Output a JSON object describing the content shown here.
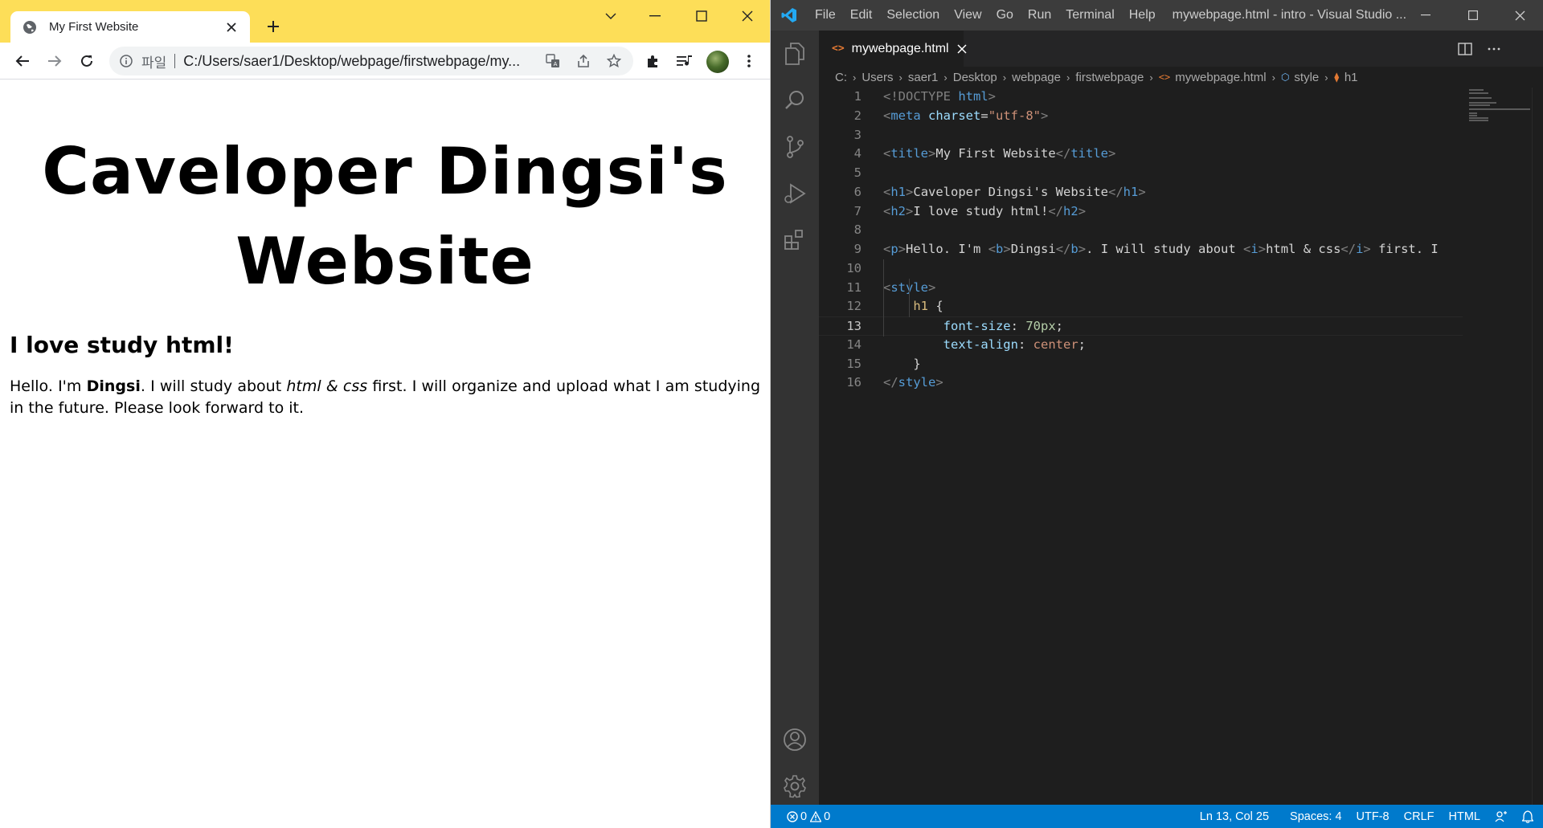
{
  "browser": {
    "tab": {
      "title": "My First Website"
    },
    "omnibox": {
      "security_label": "파일",
      "url": "C:/Users/saer1/Desktop/webpage/firstwebpage/my..."
    },
    "page": {
      "h1": "Caveloper Dingsi's Website",
      "h2": "I love study html!",
      "paragraph": {
        "part1": "Hello. I'm ",
        "bold": "Dingsi",
        "part2": ". I will study about ",
        "italic": "html & css",
        "part3": " first. I will organize and upload what I am studying in the future. Please look forward to it."
      }
    },
    "colors": {
      "titlebar": "#fdde58"
    }
  },
  "vscode": {
    "menu": [
      "File",
      "Edit",
      "Selection",
      "View",
      "Go",
      "Run",
      "Terminal",
      "Help"
    ],
    "window_title": "mywebpage.html - intro - Visual Studio ...",
    "tab": {
      "label": "mywebpage.html"
    },
    "breadcrumb": [
      "C:",
      "Users",
      "saer1",
      "Desktop",
      "webpage",
      "firstwebpage",
      "mywebpage.html",
      "style",
      "h1"
    ],
    "line_numbers": [
      "1",
      "2",
      "3",
      "4",
      "5",
      "6",
      "7",
      "8",
      "9",
      "10",
      "11",
      "12",
      "13",
      "14",
      "15",
      "16"
    ],
    "code": {
      "l1_doctype": "<!DOCTYPE",
      "l1_html": "html",
      "l2_meta": "meta",
      "l2_attr": "charset",
      "l2_val": "\"utf-8\"",
      "l4_title_tag": "title",
      "l4_title_text": "My First Website",
      "l6_tag": "h1",
      "l6_text": "Caveloper Dingsi's Website",
      "l7_tag": "h2",
      "l7_text": "I love study html!",
      "l9_p": "p",
      "l9_t1": "Hello. I'm ",
      "l9_b": "b",
      "l9_t2": "Dingsi",
      "l9_t3": ". I will study about ",
      "l9_i": "i",
      "l9_t4": "html & css",
      "l9_t5": " first. I",
      "l11_style": "style",
      "l12_sel": "h1",
      "l13_prop": "font-size",
      "l13_val": "70px",
      "l14_prop": "text-align",
      "l14_val": "center"
    },
    "status": {
      "errors": "0",
      "warnings": "0",
      "position": "Ln 13, Col 25",
      "spaces": "Spaces: 4",
      "encoding": "UTF-8",
      "eol": "CRLF",
      "language": "HTML"
    },
    "colors": {
      "statusbar": "#007acc",
      "editor_bg": "#1e1e1e"
    }
  }
}
